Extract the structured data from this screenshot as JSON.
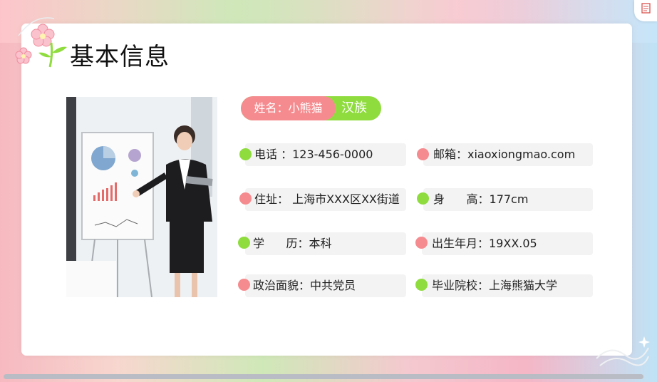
{
  "slide": {
    "title": "基本信息",
    "name": "姓名：小熊猫",
    "ethnicity": "汉族",
    "fields": {
      "phone": "电话 ：123-456-0000",
      "email": "邮箱：xiaoxiongmao.com",
      "address": "住址： 上海市XXX区XX街道",
      "height": "身      高：177cm",
      "education": "学      历：本科",
      "birth": "出生年月：19XX.05",
      "politics": "政治面貌：中共党员",
      "school": "毕业院校：上海熊猫大学"
    }
  },
  "colors": {
    "pink": "#f58b8f",
    "green": "#8fdc3f",
    "field_bg": "#f3f3f3"
  },
  "icons": [
    "flower-icon",
    "presentation-photo",
    "file-export-icon"
  ]
}
